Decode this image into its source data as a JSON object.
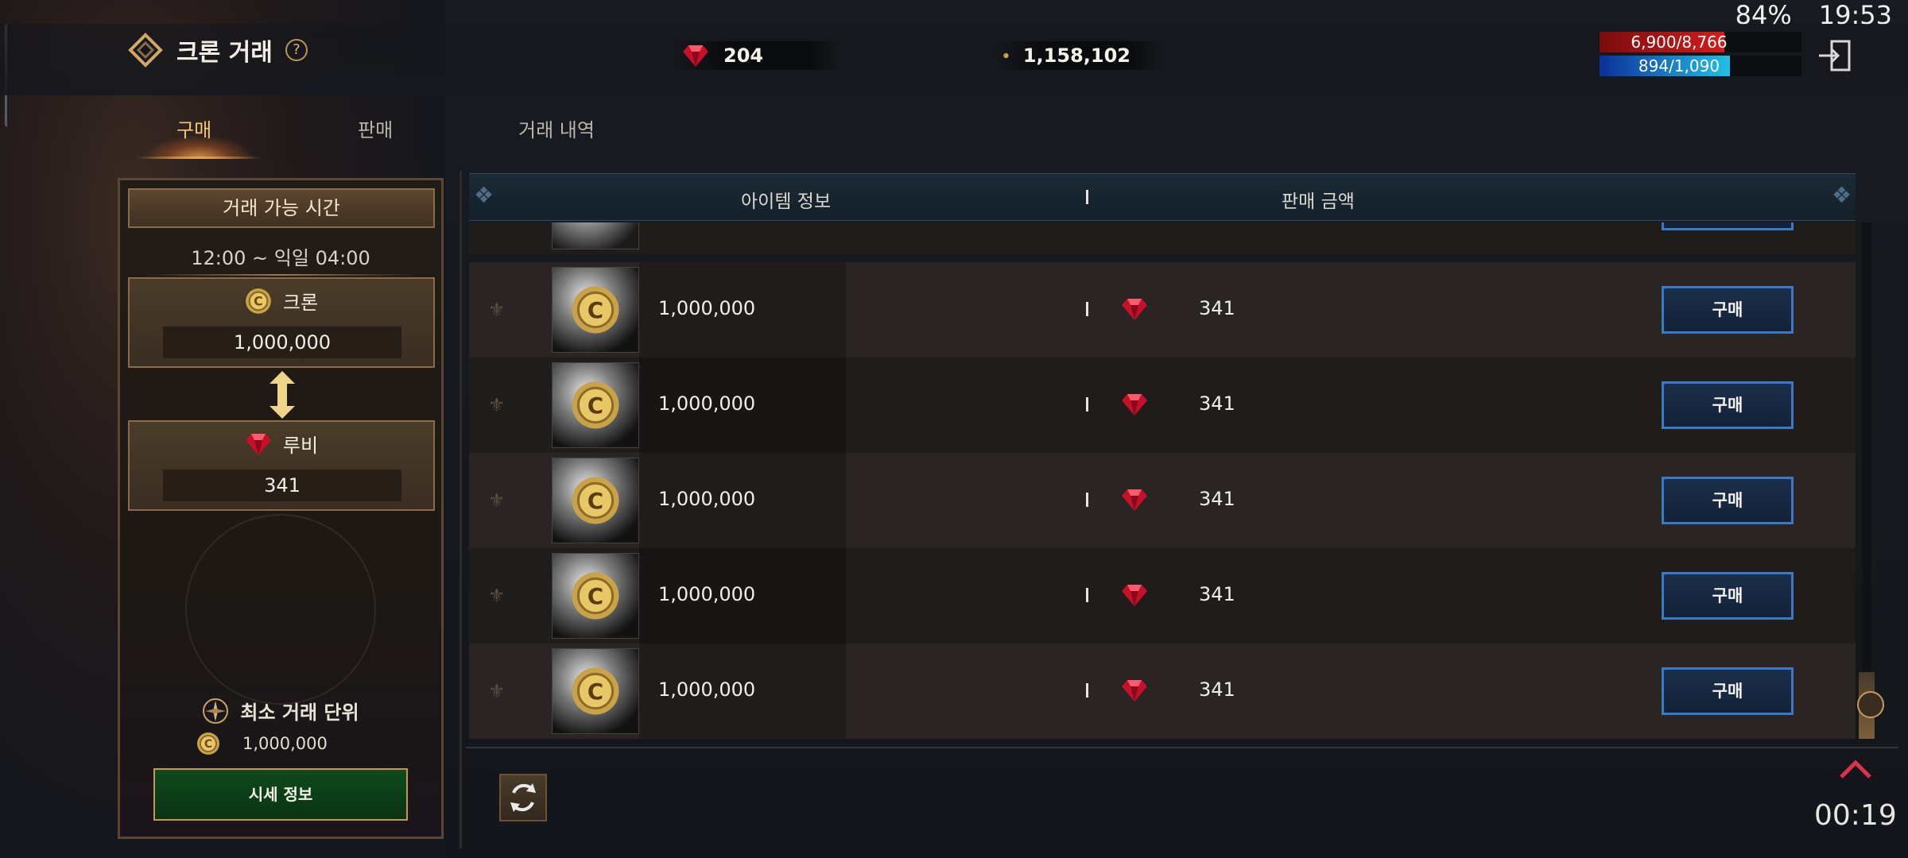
{
  "status_bar": {
    "battery": "84%",
    "time": "19:53"
  },
  "header": {
    "title": "크론 거래",
    "help_icon": "?",
    "ruby_balance": "204",
    "gold_balance": "1,158,102",
    "hp": {
      "text": "6,900/8,766",
      "fraction": 0.787
    },
    "mp": {
      "text": "894/1,090",
      "fraction": 0.82
    }
  },
  "tabs": [
    "구매",
    "판매",
    "거래 내역"
  ],
  "left_panel": {
    "trade_hours_title": "거래 가능 시간",
    "trade_hours": "12:00 ~ 익일 04:00",
    "kron_label": "크론",
    "kron_value": "1,000,000",
    "ruby_label": "루비",
    "ruby_value": "341",
    "min_unit_label": "최소 거래 단위",
    "min_unit_value": "1,000,000",
    "market_button": "시세 정보"
  },
  "table": {
    "headers": {
      "item_info": "아이템 정보",
      "sale_price": "판매 금액"
    },
    "rows": [
      {
        "amount": "1,000,000",
        "price": "341",
        "buy": "구매"
      },
      {
        "amount": "1,000,000",
        "price": "341",
        "buy": "구매"
      },
      {
        "amount": "1,000,000",
        "price": "341",
        "buy": "구매"
      },
      {
        "amount": "1,000,000",
        "price": "341",
        "buy": "구매"
      },
      {
        "amount": "1,000,000",
        "price": "341",
        "buy": "구매"
      }
    ]
  },
  "timer": "00:19",
  "icons": {
    "title": "kron-trade-diamond-icon",
    "ruby": "ruby-gem-icon",
    "gold": "kron-coin-icon",
    "exit": "exit-door-icon",
    "refresh": "refresh-icon",
    "collapse": "chevron-up-icon"
  },
  "colors": {
    "hp": "#d41b1b",
    "mp": "#21c1e6",
    "buy_border": "#3a78c8",
    "active_tab": "#f3c678",
    "market_button": "#0f4a1d"
  }
}
